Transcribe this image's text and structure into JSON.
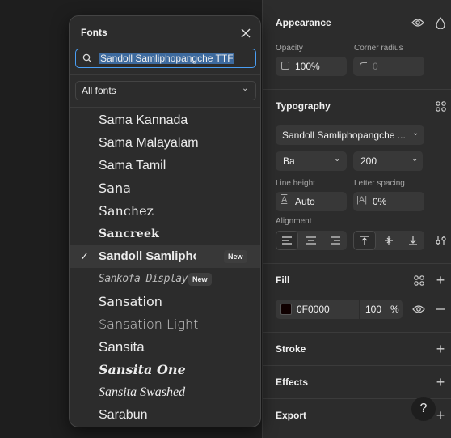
{
  "appearance": {
    "title": "Appearance",
    "opacity_label": "Opacity",
    "opacity_value": "100%",
    "corner_radius_label": "Corner radius",
    "corner_radius_value": "0"
  },
  "typography": {
    "title": "Typography",
    "font_family": "Sandoll Samliphopangche ...",
    "font_style": "Ba",
    "font_size": "200",
    "line_height_label": "Line height",
    "line_height_value": "Auto",
    "letter_spacing_label": "Letter spacing",
    "letter_spacing_value": "0%",
    "alignment_label": "Alignment"
  },
  "fill": {
    "title": "Fill",
    "color_hex": "0F0000",
    "swatch_color": "#0f0000",
    "opacity": "100",
    "percent": "%"
  },
  "sections": {
    "stroke": "Stroke",
    "effects": "Effects",
    "export": "Export"
  },
  "help_label": "?",
  "fonts_popup": {
    "title": "Fonts",
    "search_value": "Sandoll Samliphopangche TTF",
    "filter_value": "All fonts",
    "new_badge": "New",
    "items": [
      {
        "label": "Sama Kannada"
      },
      {
        "label": "Sama Malayalam"
      },
      {
        "label": "Sama Tamil"
      },
      {
        "label": "Sana"
      },
      {
        "label": "Sanchez"
      },
      {
        "label": "Sancreek"
      },
      {
        "label": "Sandoll Samliphopangche",
        "selected": true,
        "new": true
      },
      {
        "label": "Sankofa Display",
        "new": true
      },
      {
        "label": "Sansation"
      },
      {
        "label": "Sansation Light"
      },
      {
        "label": "Sansita"
      },
      {
        "label": "Sansita One"
      },
      {
        "label": "Sansita Swashed"
      },
      {
        "label": "Sarabun"
      }
    ]
  }
}
